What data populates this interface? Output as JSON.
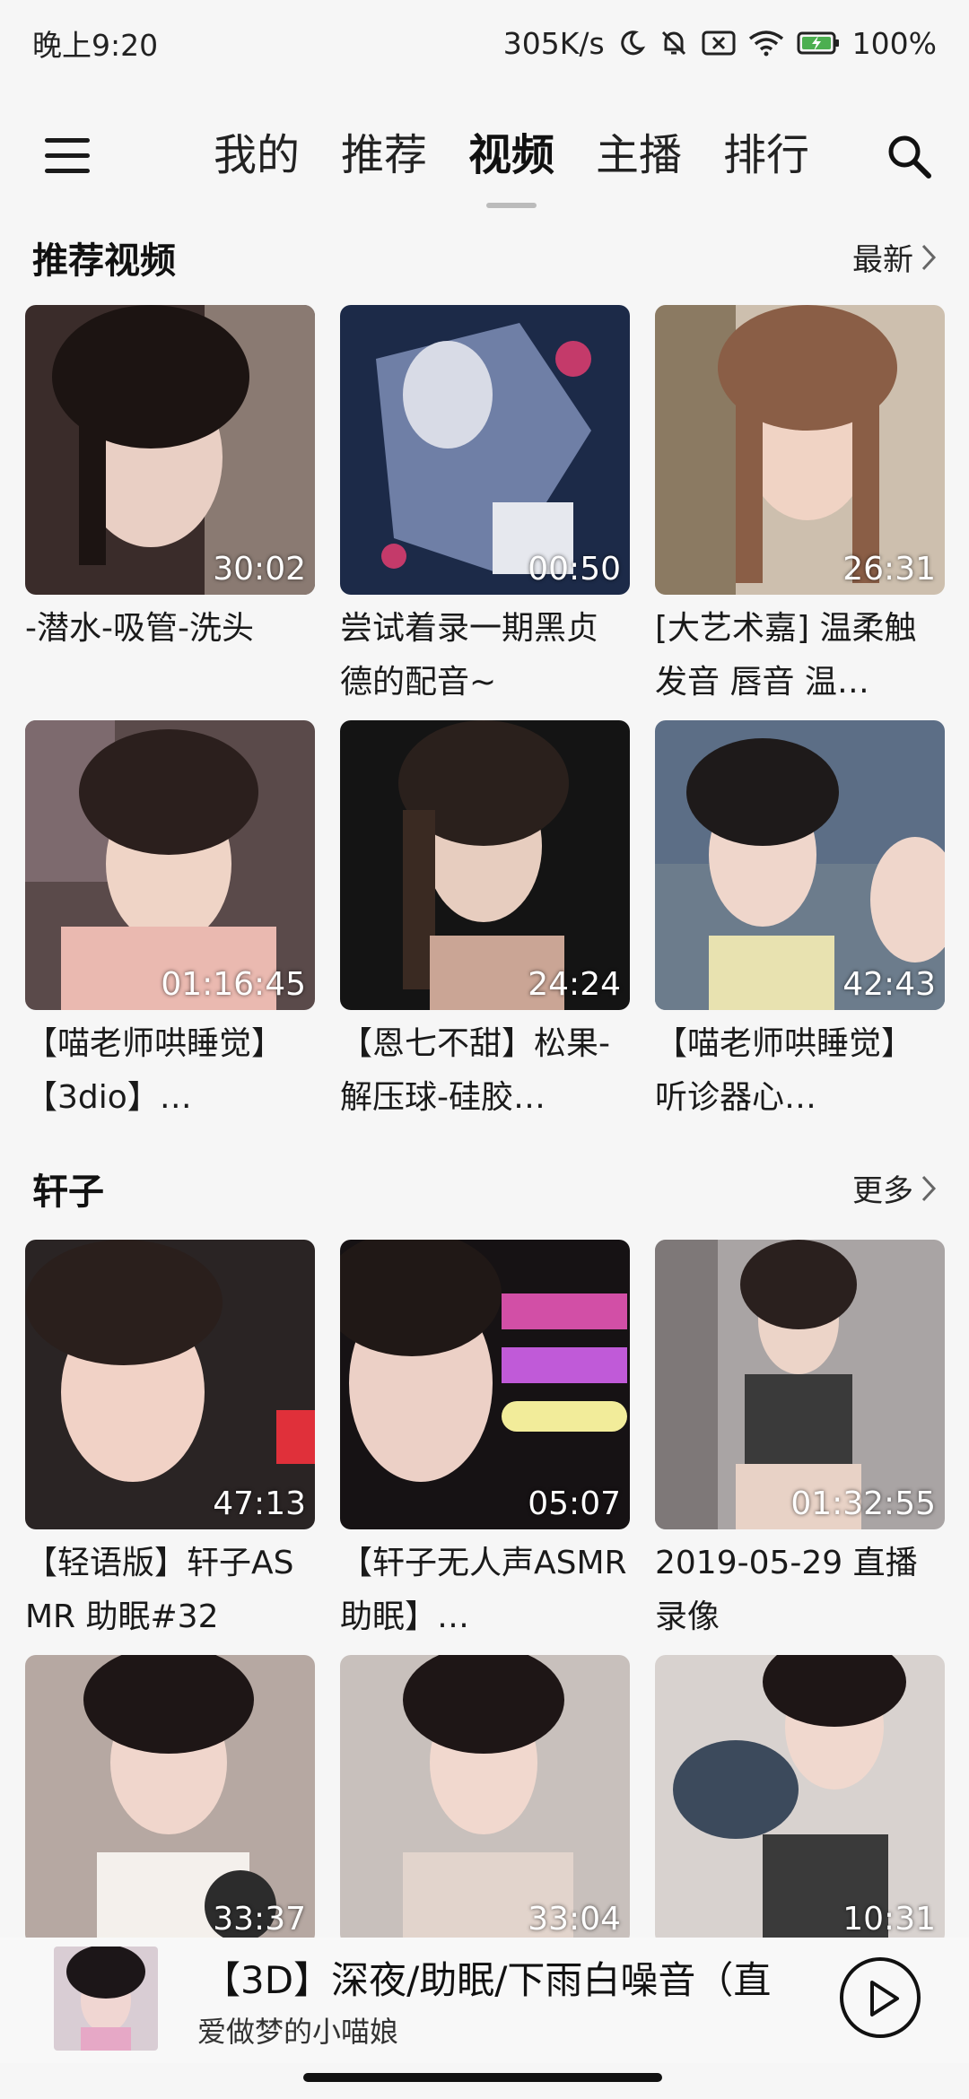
{
  "status_bar": {
    "time": "晚上9:20",
    "network_speed": "305K/s",
    "battery": "100%"
  },
  "nav": {
    "tabs": [
      {
        "label": "我的"
      },
      {
        "label": "推荐"
      },
      {
        "label": "视频"
      },
      {
        "label": "主播"
      },
      {
        "label": "排行"
      }
    ],
    "active_tab": "视频"
  },
  "sections": [
    {
      "title": "推荐视频",
      "more_label": "最新",
      "videos": [
        {
          "caption": "-潜水-吸管-洗头",
          "duration": "30:02"
        },
        {
          "caption": "尝试着录一期黑贞德的配音~",
          "duration": "00:50"
        },
        {
          "caption": "[大艺术嘉] 温柔触发音  唇音  温…",
          "duration": "26:31"
        },
        {
          "caption": "【喵老师哄睡觉】【3dio】…",
          "duration": "01:16:45"
        },
        {
          "caption": "【恩七不甜】松果-解压球-硅胶…",
          "duration": "24:24"
        },
        {
          "caption": "【喵老师哄睡觉】听诊器心…",
          "duration": "42:43"
        }
      ]
    },
    {
      "title": "轩子",
      "more_label": "更多",
      "videos": [
        {
          "caption": "【轻语版】轩子ASMR 助眠#32",
          "duration": "47:13"
        },
        {
          "caption": "【轩子无人声ASMR助眠】…",
          "duration": "05:07"
        },
        {
          "caption": "2019-05-29 直播录像",
          "duration": "01:32:55"
        },
        {
          "caption": "",
          "duration": "33:37"
        },
        {
          "caption": "",
          "duration": "33:04"
        },
        {
          "caption": "",
          "duration": "10:31"
        }
      ]
    }
  ],
  "player": {
    "title": "【3D】深夜/助眠/下雨白噪音（直",
    "artist": "爱做梦的小喵娘"
  },
  "colors": {
    "background": "#f6f6f6",
    "text": "#1a1a1a",
    "tab_indicator": "#bbbbbb"
  }
}
